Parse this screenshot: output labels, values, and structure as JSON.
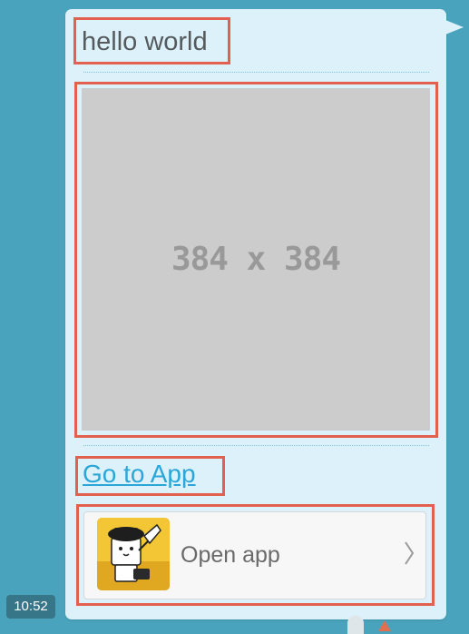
{
  "message": {
    "title": "hello world",
    "image_placeholder_label": "384 x 384",
    "link_text": "Go to App",
    "app_card": {
      "label": "Open app",
      "icon": "app-mascot-icon",
      "chevron": "chevron-right-icon"
    },
    "time": "10:52"
  },
  "colors": {
    "background": "#4aa3bd",
    "bubble": "#ddf1fb",
    "link": "#2aa6d8",
    "highlight": "#e4604e",
    "placeholder": "#cccccc"
  }
}
